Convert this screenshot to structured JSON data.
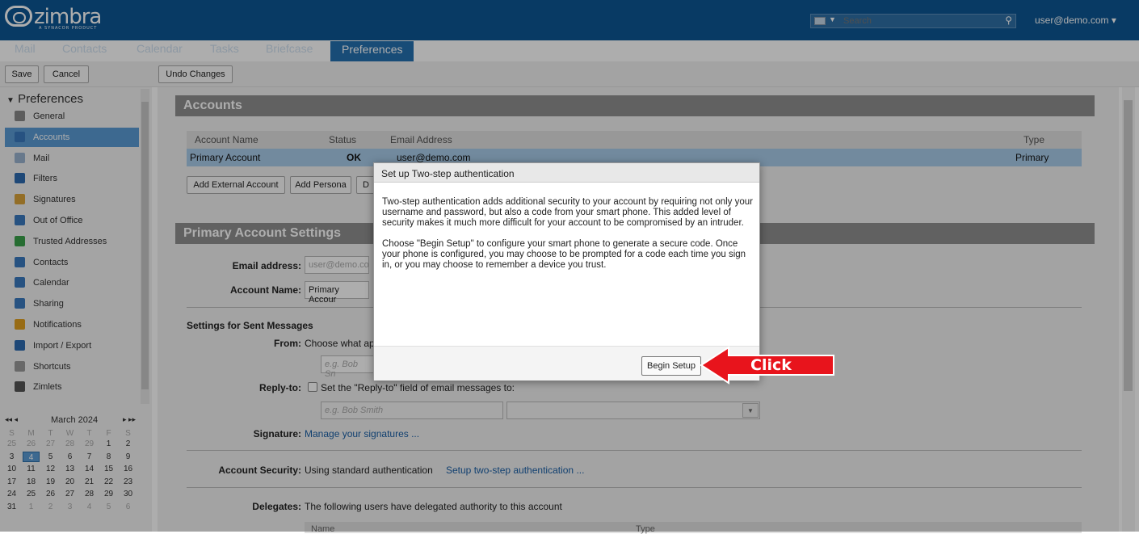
{
  "brand": {
    "name": "zimbra",
    "tagline": "A SYNACOR PRODUCT"
  },
  "header": {
    "search_placeholder": "Search",
    "user": "user@demo.com",
    "user_caret": "▾",
    "tabs": [
      "Mail",
      "Contacts",
      "Calendar",
      "Tasks",
      "Briefcase",
      "Preferences"
    ],
    "active_tab": "Preferences"
  },
  "toolbar": {
    "save": "Save",
    "cancel": "Cancel",
    "undo": "Undo Changes"
  },
  "sidebar": {
    "title": "Preferences",
    "items": [
      {
        "label": "General",
        "icon": "gear-icon",
        "color": "#888888"
      },
      {
        "label": "Accounts",
        "icon": "account-icon",
        "color": "#3a7abf",
        "selected": true
      },
      {
        "label": "Mail",
        "icon": "mail-icon",
        "color": "#9ab3cf"
      },
      {
        "label": "Filters",
        "icon": "filter-icon",
        "color": "#2d6bb0"
      },
      {
        "label": "Signatures",
        "icon": "signature-icon",
        "color": "#d9a23a"
      },
      {
        "label": "Out of Office",
        "icon": "out-of-office-icon",
        "color": "#3a7abf"
      },
      {
        "label": "Trusted Addresses",
        "icon": "shield-icon",
        "color": "#3aa14a"
      },
      {
        "label": "Contacts",
        "icon": "contacts-icon",
        "color": "#3a7abf"
      },
      {
        "label": "Calendar",
        "icon": "calendar-icon",
        "color": "#3a7abf"
      },
      {
        "label": "Sharing",
        "icon": "sharing-icon",
        "color": "#3a7abf"
      },
      {
        "label": "Notifications",
        "icon": "bell-icon",
        "color": "#e0a020"
      },
      {
        "label": "Import / Export",
        "icon": "import-export-icon",
        "color": "#2d6bb0"
      },
      {
        "label": "Shortcuts",
        "icon": "shortcut-icon",
        "color": "#9a9a9a"
      },
      {
        "label": "Zimlets",
        "icon": "zimlet-icon",
        "color": "#555555"
      }
    ]
  },
  "calendar": {
    "month": "March 2024",
    "nav_prev": "◂◂ ◂",
    "nav_next": "▸ ▸▸",
    "weekdays": [
      "S",
      "M",
      "T",
      "W",
      "T",
      "F",
      "S"
    ],
    "weeks": [
      [
        "25",
        "26",
        "27",
        "28",
        "29",
        "1",
        "2"
      ],
      [
        "3",
        "4",
        "5",
        "6",
        "7",
        "8",
        "9"
      ],
      [
        "10",
        "11",
        "12",
        "13",
        "14",
        "15",
        "16"
      ],
      [
        "17",
        "18",
        "19",
        "20",
        "21",
        "22",
        "23"
      ],
      [
        "24",
        "25",
        "26",
        "27",
        "28",
        "29",
        "30"
      ],
      [
        "31",
        "1",
        "2",
        "3",
        "4",
        "5",
        "6"
      ]
    ],
    "today": "4"
  },
  "accounts": {
    "section_title": "Accounts",
    "columns": [
      "Account Name",
      "Status",
      "Email Address",
      "Type"
    ],
    "row": {
      "name": "Primary Account",
      "status": "OK",
      "email": "user@demo.com",
      "type": "Primary"
    },
    "buttons": [
      "Add External Account",
      "Add Persona",
      "D"
    ]
  },
  "primary": {
    "section_title": "Primary Account Settings",
    "email_label": "Email address:",
    "email_value": "user@demo.co",
    "name_label": "Account Name:",
    "name_value": "Primary Accour",
    "sent_heading": "Settings for Sent Messages",
    "from_label": "From:",
    "from_text": "Choose what ap",
    "from_placeholder": "e.g. Bob Sn",
    "replyto_label": "Reply-to:",
    "replyto_text": "Set the \"Reply-to\" field of email messages to:",
    "replyto_placeholder": "e.g. Bob Smith",
    "signature_label": "Signature:",
    "signature_link": "Manage your signatures ...",
    "security_label": "Account Security:",
    "security_text": "Using standard authentication",
    "security_link": "Setup two-step authentication ...",
    "delegates_label": "Delegates:",
    "delegates_text": "The following users have delegated authority to this account",
    "delegates_cols": [
      "Name",
      "Type"
    ]
  },
  "dialog": {
    "title": "Set up Two-step authentication",
    "para1": "Two-step authentication adds additional security to your account by requiring not only your username and password, but also a code from your smart phone. This added level of security makes it much more difficult for your account to be compromised by an intruder.",
    "para2": "Choose \"Begin Setup\" to configure your smart phone to generate a secure code. Once your phone is configured, you may choose to be prompted for a code each time you sign in, or you may choose to remember a device you trust.",
    "button": "Begin Setup"
  },
  "annotation": {
    "label": "Click",
    "color": "#e8141c"
  }
}
